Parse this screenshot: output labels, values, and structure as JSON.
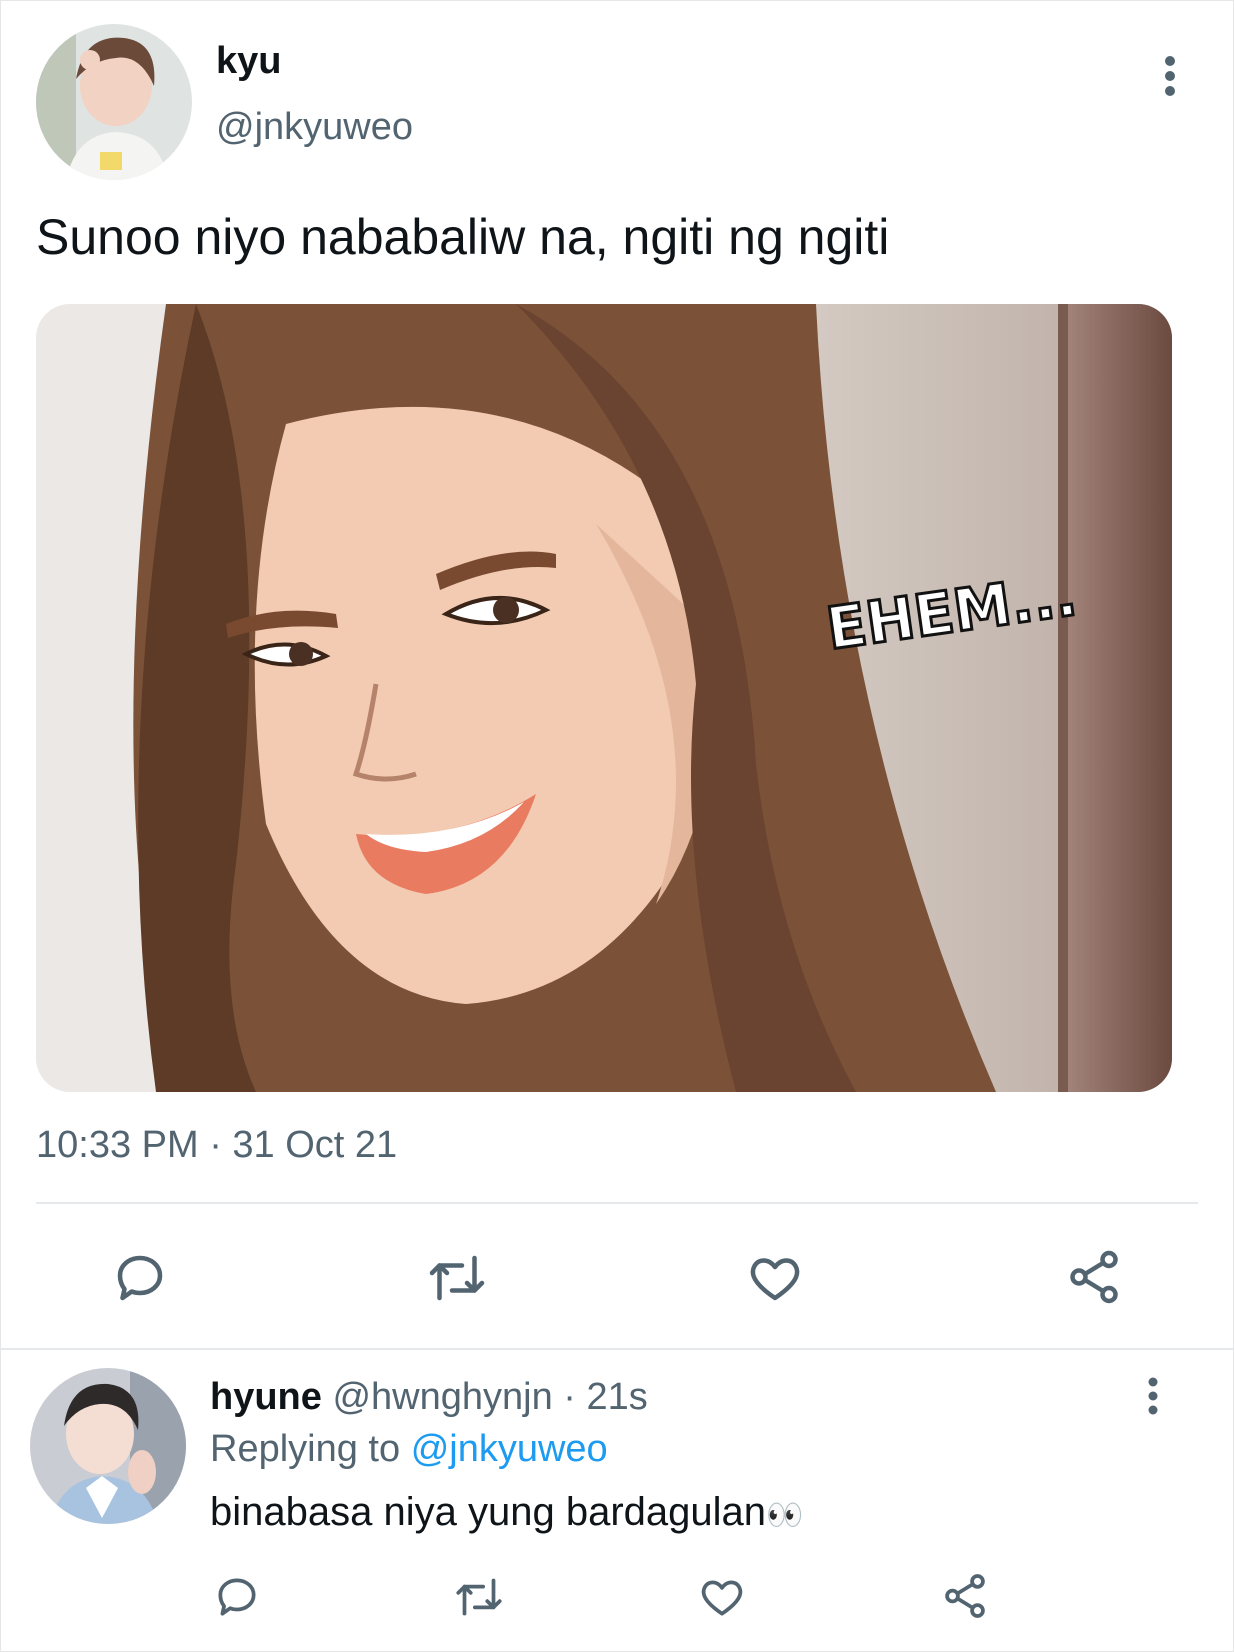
{
  "tweet": {
    "author": {
      "name": "kyu",
      "handle": "@jnkyuweo"
    },
    "text": "Sunoo niyo nababaliw na, ngiti ng ngiti",
    "media": {
      "caption_text": "EHEM..."
    },
    "timestamp": "10:33 PM · 31 Oct 21",
    "actions": [
      "reply-icon",
      "retweet-icon",
      "like-icon",
      "share-icon"
    ]
  },
  "reply": {
    "author": {
      "name": "hyune",
      "handle": "@hwnghynjn",
      "time": "· 21s"
    },
    "replying_label": "Replying to",
    "replying_to": "@jnkyuweo",
    "text": "binabasa niya yung bardagulan",
    "emoji": "👀",
    "actions": [
      "reply-icon",
      "retweet-icon",
      "like-icon",
      "share-icon"
    ]
  },
  "colors": {
    "accent": "#1d9bf0",
    "muted": "#536471",
    "text": "#0f1419"
  }
}
